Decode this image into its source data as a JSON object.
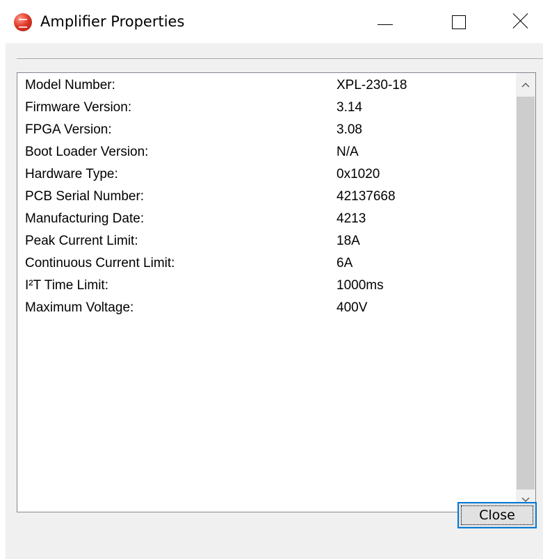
{
  "window": {
    "title": "Amplifier Properties",
    "app_icon": "amplifier-app-icon",
    "controls": {
      "minimize_icon": "minimize-icon",
      "maximize_icon": "maximize-icon",
      "close_icon": "close-icon"
    }
  },
  "properties": [
    {
      "label": "Model Number:",
      "value": "XPL-230-18"
    },
    {
      "label": "Firmware Version:",
      "value": "3.14"
    },
    {
      "label": "FPGA Version:",
      "value": "3.08"
    },
    {
      "label": "Boot Loader Version:",
      "value": "N/A"
    },
    {
      "label": "Hardware Type:",
      "value": "0x1020"
    },
    {
      "label": "PCB Serial Number:",
      "value": "42137668"
    },
    {
      "label": "Manufacturing Date:",
      "value": "4213"
    },
    {
      "label": "Peak Current Limit:",
      "value": "18A"
    },
    {
      "label": "Continuous Current Limit:",
      "value": "6A"
    },
    {
      "label": "I²T Time Limit:",
      "value": "1000ms"
    },
    {
      "label": "Maximum Voltage:",
      "value": "400V"
    }
  ],
  "scrollbar": {
    "up_icon": "chevron-up-icon",
    "down_icon": "chevron-down-icon"
  },
  "buttons": {
    "close_label": "Close"
  },
  "colors": {
    "dialog_background": "#f0f0f0",
    "focus_border": "#0078d7",
    "button_face": "#e1e1e1",
    "scroll_thumb": "#cdcdcd"
  }
}
